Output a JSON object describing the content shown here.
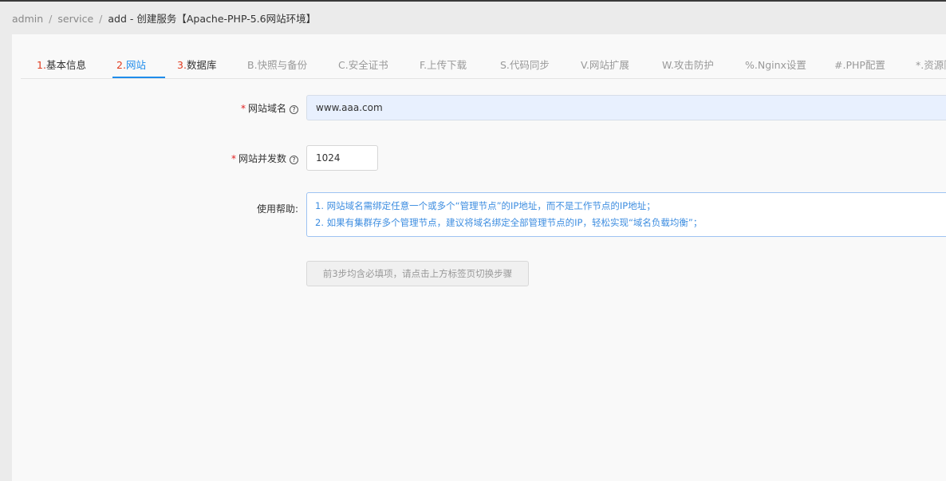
{
  "breadcrumb": {
    "items": [
      "admin",
      "service"
    ],
    "current": "add - 创建服务【Apache-PHP-5.6网站环境】"
  },
  "tabs": [
    {
      "prefix": "1.",
      "label": "基本信息"
    },
    {
      "prefix": "2.",
      "label": "网站"
    },
    {
      "prefix": "3.",
      "label": "数据库"
    },
    {
      "prefix": "B.",
      "label": "快照与备份"
    },
    {
      "prefix": "C.",
      "label": "安全证书"
    },
    {
      "prefix": "F.",
      "label": "上传下载"
    },
    {
      "prefix": "S.",
      "label": "代码同步"
    },
    {
      "prefix": "V.",
      "label": "网站扩展"
    },
    {
      "prefix": "W.",
      "label": "攻击防护"
    },
    {
      "prefix": "%.",
      "label": "Nginx设置"
    },
    {
      "prefix": "#.",
      "label": "PHP配置"
    },
    {
      "prefix": "*.",
      "label": "资源限"
    }
  ],
  "active_tab": "2.网站",
  "form": {
    "domain": {
      "label": "网站域名",
      "value": "www.aaa.com"
    },
    "concurrency": {
      "label": "网站并发数",
      "value": "1024"
    },
    "help": {
      "label": "使用帮助:",
      "lines": [
        "1. 网站域名需绑定任意一个或多个“管理节点”的IP地址，而不是工作节点的IP地址；",
        "2. 如果有集群存多个管理节点，建议将域名绑定全部管理节点的IP，轻松实现“域名负载均衡”；"
      ]
    },
    "submit_label": "前3步均含必填项，请点击上方标签页切换步骤"
  },
  "colors": {
    "accent": "#1f8ceb",
    "required": "#e03b1f",
    "help_text": "#3d8de0"
  }
}
